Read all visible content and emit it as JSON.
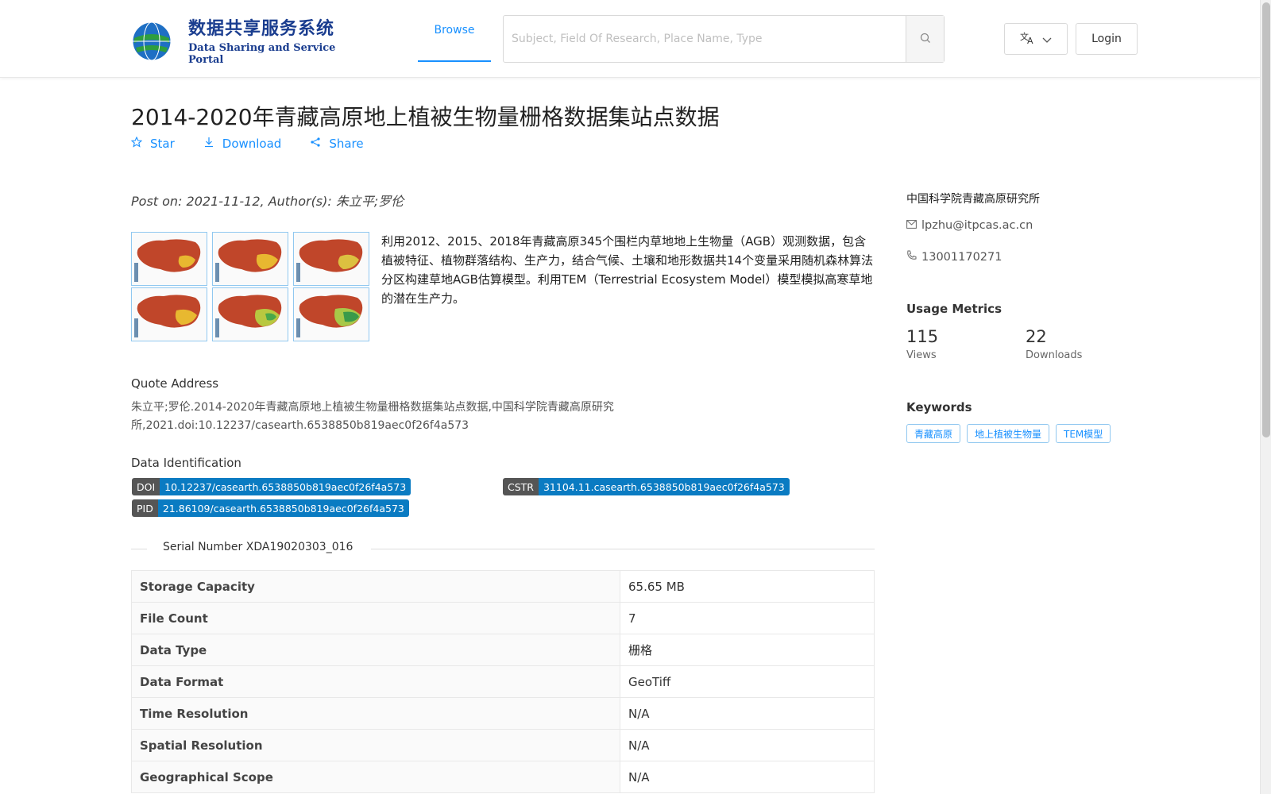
{
  "header": {
    "logo_cn": "数据共享服务系统",
    "logo_en": "Data Sharing and Service Portal",
    "nav_browse": "Browse",
    "search_placeholder": "Subject, Field Of Research, Place Name, Type",
    "login": "Login"
  },
  "dataset": {
    "title": "2014-2020年青藏高原地上植被生物量栅格数据集站点数据",
    "actions": {
      "star": "Star",
      "download": "Download",
      "share": "Share"
    },
    "post_on": "Post on: 2021-11-12, Author(s): ",
    "authors": "朱立平;罗伦",
    "abstract": "利用2012、2015、2018年青藏高原345个围栏内草地地上生物量（AGB）观测数据，包含植被特征、植物群落结构、生产力，结合气候、土壤和地形数据共14个变量采用随机森林算法分区构建草地AGB估算模型。利用TEM（Terrestrial Ecosystem Model）模型模拟高寒草地的潜在生产力。",
    "quote_label": "Quote Address",
    "quote_text": "朱立平;罗伦.2014-2020年青藏高原地上植被生物量栅格数据集站点数据,中国科学院青藏高原研究所,2021.doi:10.12237/casearth.6538850b819aec0f26f4a573",
    "ident_label": "Data Identification",
    "doi_key": "DOI",
    "doi_val": "10.12237/casearth.6538850b819aec0f26f4a573",
    "cstr_key": "CSTR",
    "cstr_val": "31104.11.casearth.6538850b819aec0f26f4a573",
    "pid_key": "PID",
    "pid_val": "21.86109/casearth.6538850b819aec0f26f4a573",
    "serial": "Serial Number XDA19020303_016",
    "meta": [
      {
        "key": "Storage Capacity",
        "value": "65.65 MB"
      },
      {
        "key": "File Count",
        "value": "7"
      },
      {
        "key": "Data Type",
        "value": "栅格"
      },
      {
        "key": "Data Format",
        "value": "GeoTiff"
      },
      {
        "key": "Time Resolution",
        "value": "N/A"
      },
      {
        "key": "Spatial Resolution",
        "value": "N/A"
      },
      {
        "key": "Geographical Scope",
        "value": "N/A"
      }
    ]
  },
  "sidebar": {
    "org": "中国科学院青藏高原研究所",
    "email": "lpzhu@itpcas.ac.cn",
    "phone": "13001170271",
    "usage_title": "Usage Metrics",
    "views_val": "115",
    "views_lbl": "Views",
    "downloads_val": "22",
    "downloads_lbl": "Downloads",
    "keywords_title": "Keywords",
    "keywords": [
      "青藏高原",
      "地上植被生物量",
      "TEM模型"
    ]
  },
  "colors": {
    "accent": "#1890ff",
    "badge_dark": "#555555",
    "badge_blue": "#0a7bc2"
  }
}
